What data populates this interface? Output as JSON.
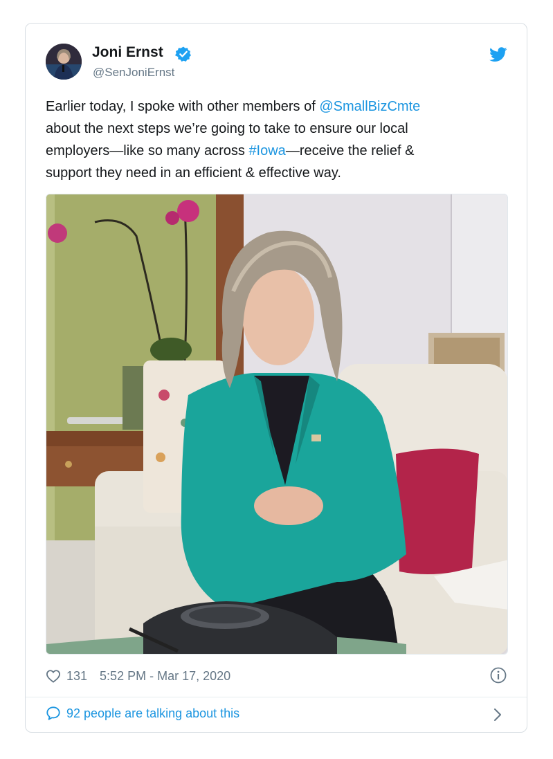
{
  "author": {
    "name": "Joni Ernst",
    "handle": "@SenJoniErnst"
  },
  "tweet": {
    "line1_prefix": "Earlier today, I spoke with other members of ",
    "line1_mention": "@SmallBizCmte",
    "line2": "about the next steps we’re going to take to ensure our local",
    "line3_prefix": "employers—like so many across ",
    "line3_hashtag": "#Iowa",
    "line3_suffix": "—receive the relief &",
    "line4": "support they need in an efficient & effective way."
  },
  "meta": {
    "likes": "131",
    "timestamp": "5:52 PM - Mar 17, 2020"
  },
  "footer": {
    "talking": "92 people are talking about this"
  },
  "icons": {
    "verified": "verified-badge-icon",
    "bird": "twitter-bird-icon",
    "like": "heart-icon",
    "info": "info-icon",
    "reply": "speech-bubble-icon",
    "chevron": "chevron-right-icon"
  },
  "colors": {
    "link": "#1b95e0",
    "secondary_text": "#657786",
    "blazer": "#1aa59b",
    "pillow": "#b3244a"
  }
}
